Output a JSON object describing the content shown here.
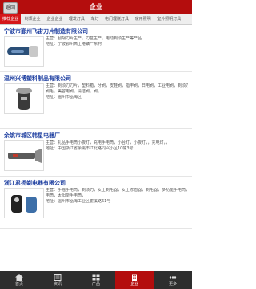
{
  "header": {
    "title": "企业",
    "back_label": "返回"
  },
  "tabs": [
    {
      "label": "推荐企业",
      "active": true
    },
    {
      "label": "剃须企业",
      "active": false
    },
    {
      "label": "企业企业",
      "active": false
    },
    {
      "label": "理发灯具",
      "active": false
    },
    {
      "label": "车灯",
      "active": false
    },
    {
      "label": "电门理脱灯具",
      "active": false
    },
    {
      "label": "家用照明",
      "active": false
    },
    {
      "label": "室外照明灯具",
      "active": false
    }
  ],
  "companies": [
    {
      "name": "宁波市鄞州飞宙刀片制造有限公司",
      "lines": [
        "主营：刮胡刀片生产，刀盒生产，电动剃须生产等产品",
        "地址：宁波鄞州高士港镇厂东村"
      ]
    },
    {
      "name": "温州兴博塑料制品有限公司",
      "lines": [
        "主营：剃须刀刀片，塑料箱，牙刷，皮鞋刷，指甲刷，日用刷，工业用刷，剃须刀刀片，",
        "刷毛，美容用刷，清洁刷，刷，",
        "地址：温州市瓯海区"
      ]
    },
    {
      "name": "余姚市城区韩星电器厂",
      "lines": [
        "主营：礼品手电筒小夜灯，充电手电筒，小台灯，小夜灯，，充电灯，，",
        "地址：中国浙江省余姚市江北路同兴小区10幢3号"
      ]
    },
    {
      "name": "浙江君扬剃电器有限公司",
      "lines": [
        "主营：手摇手电筒，剃须刀，女士剃毛器，女士修眉器，剃毛器，多功能手电筒，手",
        "电筒，太阳能手电筒，",
        "地址：温州市瓯海工业区瞿溪路61号"
      ]
    }
  ],
  "bottom_nav": [
    {
      "label": "首页",
      "icon": "home-icon",
      "active": false
    },
    {
      "label": "资讯",
      "icon": "news-icon",
      "active": false
    },
    {
      "label": "产品",
      "icon": "products-icon",
      "active": false
    },
    {
      "label": "企业",
      "icon": "company-icon",
      "active": true
    },
    {
      "label": "更多",
      "icon": "more-icon",
      "active": false
    }
  ],
  "colors": {
    "brand_red": "#b40d0d",
    "tab_active": "#d5171a",
    "link_blue": "#1d3ea0",
    "nav_dark": "#2e2e2e"
  }
}
